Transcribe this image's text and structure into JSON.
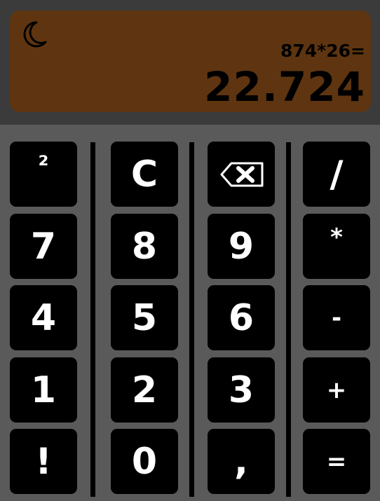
{
  "display": {
    "theme_icon": "moon-icon",
    "expression": "874*26=",
    "result": "22.724"
  },
  "keys": {
    "square": "²",
    "clear": "C",
    "backspace_icon": "backspace-icon",
    "divide": "/",
    "seven": "7",
    "eight": "8",
    "nine": "9",
    "multiply": "*",
    "four": "4",
    "five": "5",
    "six": "6",
    "minus": "-",
    "one": "1",
    "two": "2",
    "three": "3",
    "plus": "+",
    "factorial": "!",
    "zero": "0",
    "decimal": ",",
    "equals": "="
  },
  "colors": {
    "display_background": "#5e3510",
    "top_bar": "#3b3b3b",
    "keypad_background": "#5a5a5a",
    "key_background": "#000000",
    "key_text": "#ffffff"
  }
}
